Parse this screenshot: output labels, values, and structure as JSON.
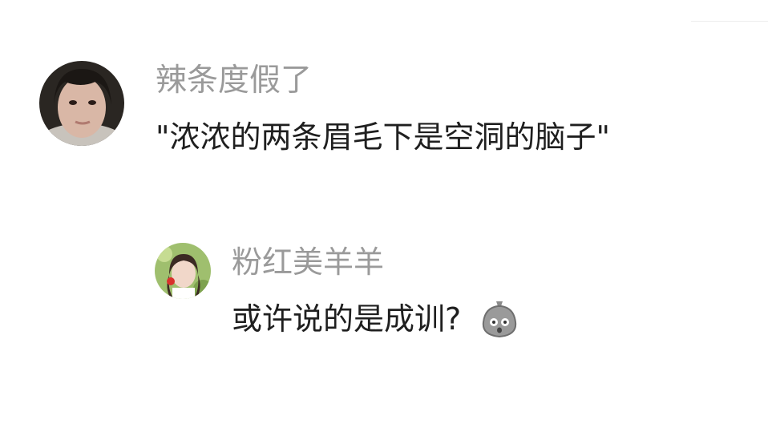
{
  "comments": [
    {
      "username": "辣条度假了",
      "text": "\"浓浓的两条眉毛下是空洞的脑子\""
    },
    {
      "username": "粉红美羊羊",
      "text": "或许说的是成训?",
      "emoji": "surprised-sack-emoji"
    }
  ]
}
